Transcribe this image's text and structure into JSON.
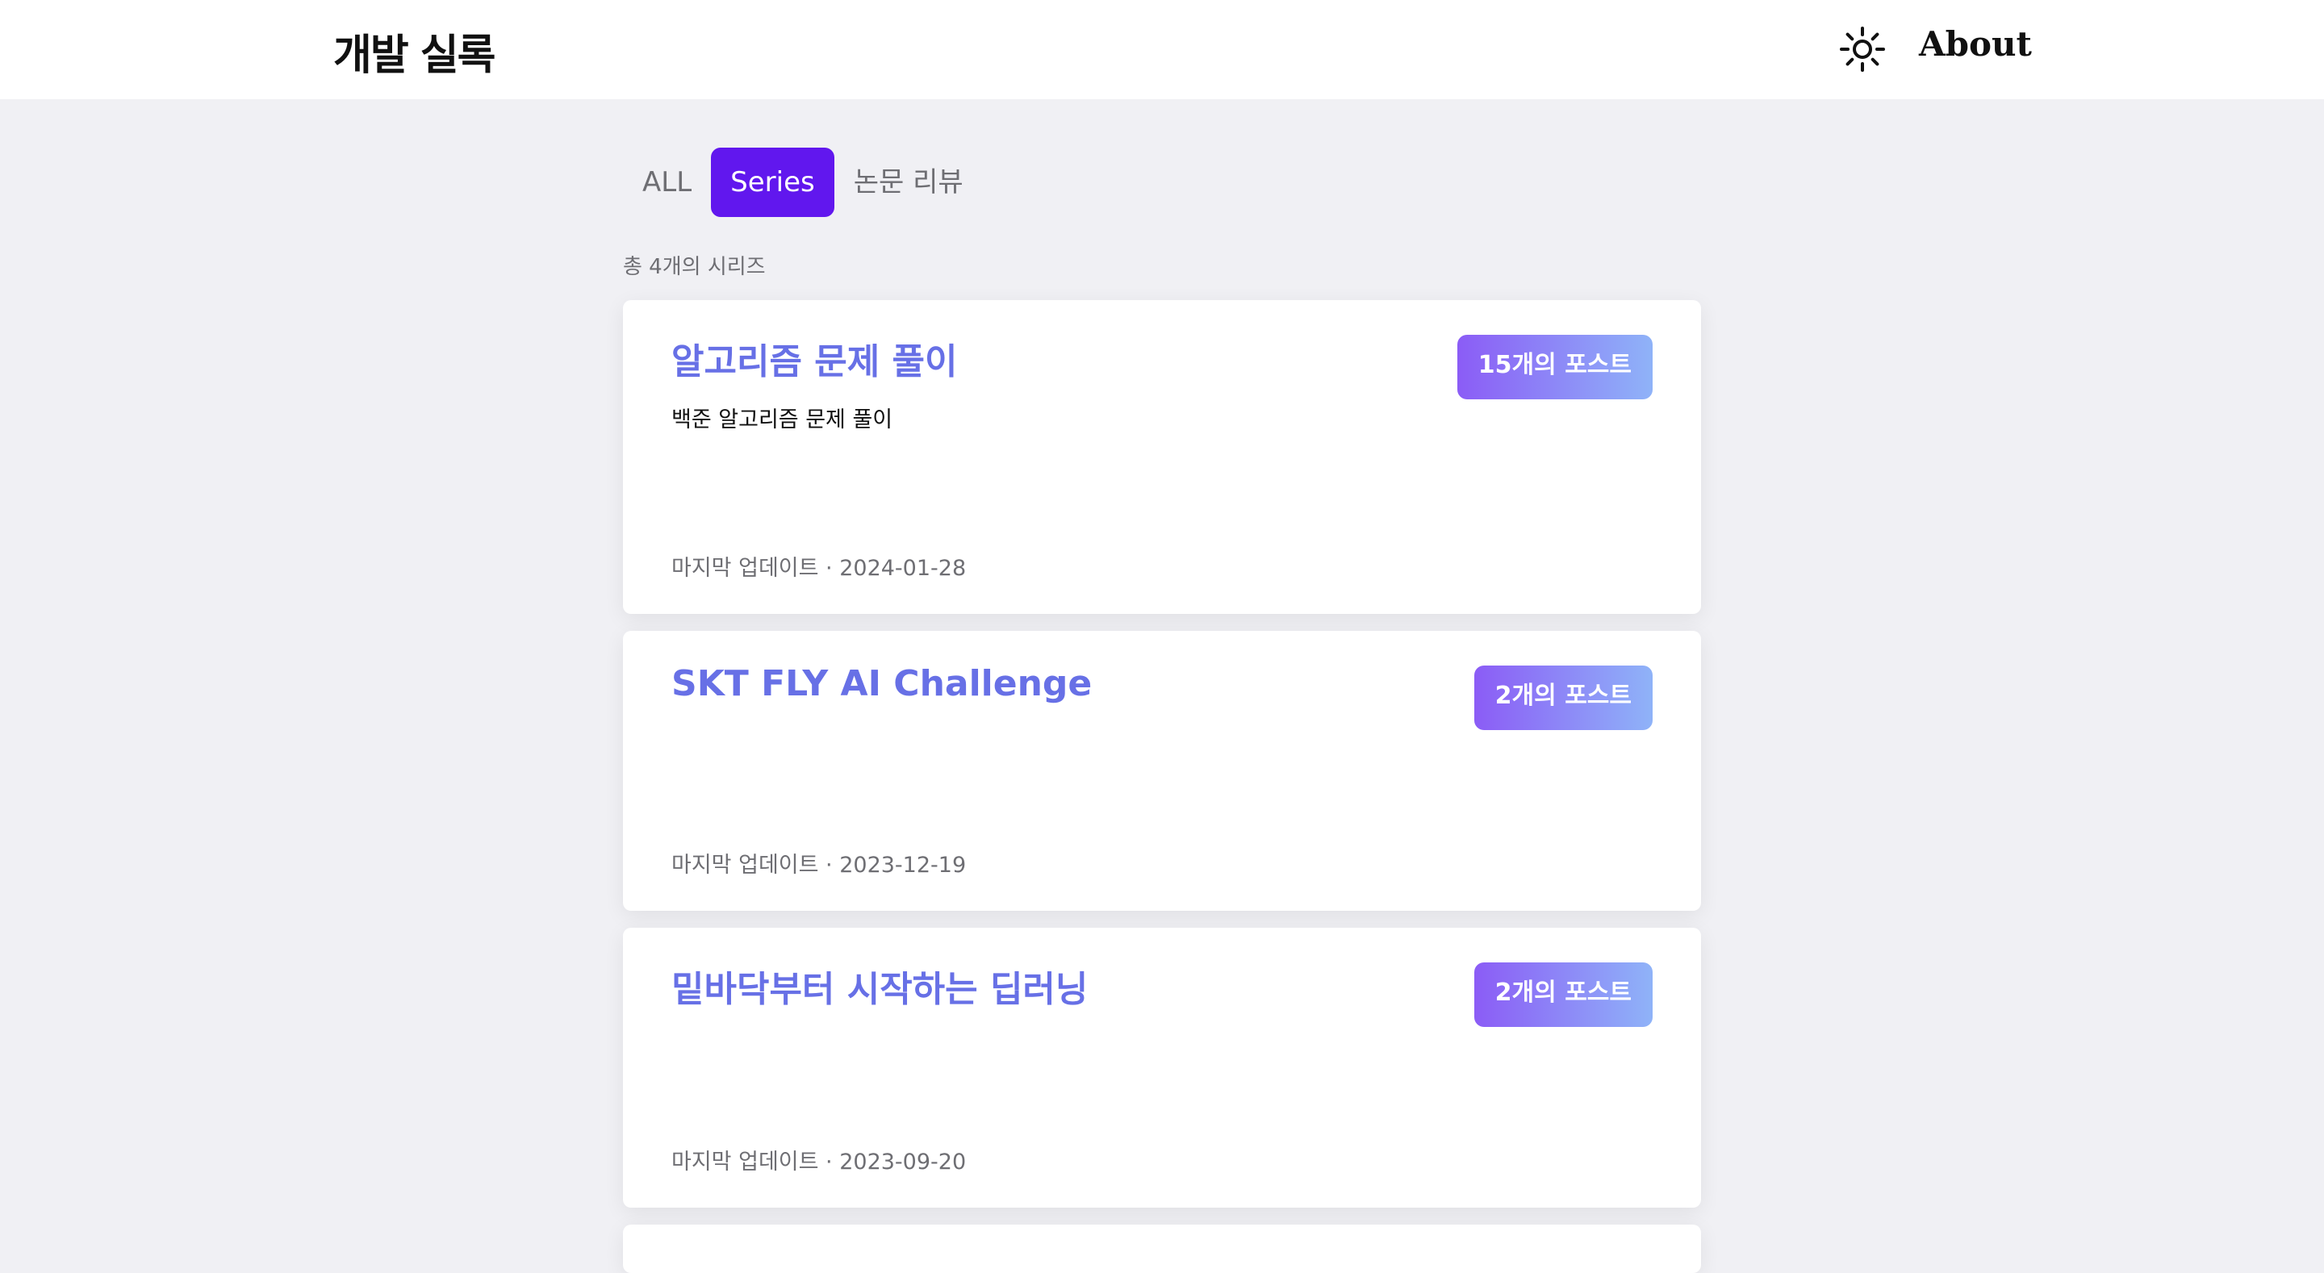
{
  "header": {
    "logo": "개발 실록",
    "theme_icon": "sun-icon",
    "about_label": "About"
  },
  "tabs": [
    {
      "label": "ALL",
      "active": false
    },
    {
      "label": "Series",
      "active": true
    },
    {
      "label": "논문 리뷰",
      "active": false
    }
  ],
  "summary": "총 4개의 시리즈",
  "series": [
    {
      "title": "알고리즘 문제 풀이",
      "description": "백준 알고리즘 문제 풀이",
      "post_count": "15개의 포스트",
      "last_updated": "마지막 업데이트 · 2024-01-28"
    },
    {
      "title": "SKT FLY AI Challenge",
      "description": "",
      "post_count": "2개의 포스트",
      "last_updated": "마지막 업데이트 · 2023-12-19"
    },
    {
      "title": "밑바닥부터 시작하는 딥러닝",
      "description": "",
      "post_count": "2개의 포스트",
      "last_updated": "마지막 업데이트 · 2023-09-20"
    }
  ],
  "colors": {
    "accent": "#6117ee",
    "title": "#6770e6",
    "background": "#f0f0f4",
    "badge_gradient_start": "#8b5cf6",
    "badge_gradient_end": "#8fb3f8"
  }
}
